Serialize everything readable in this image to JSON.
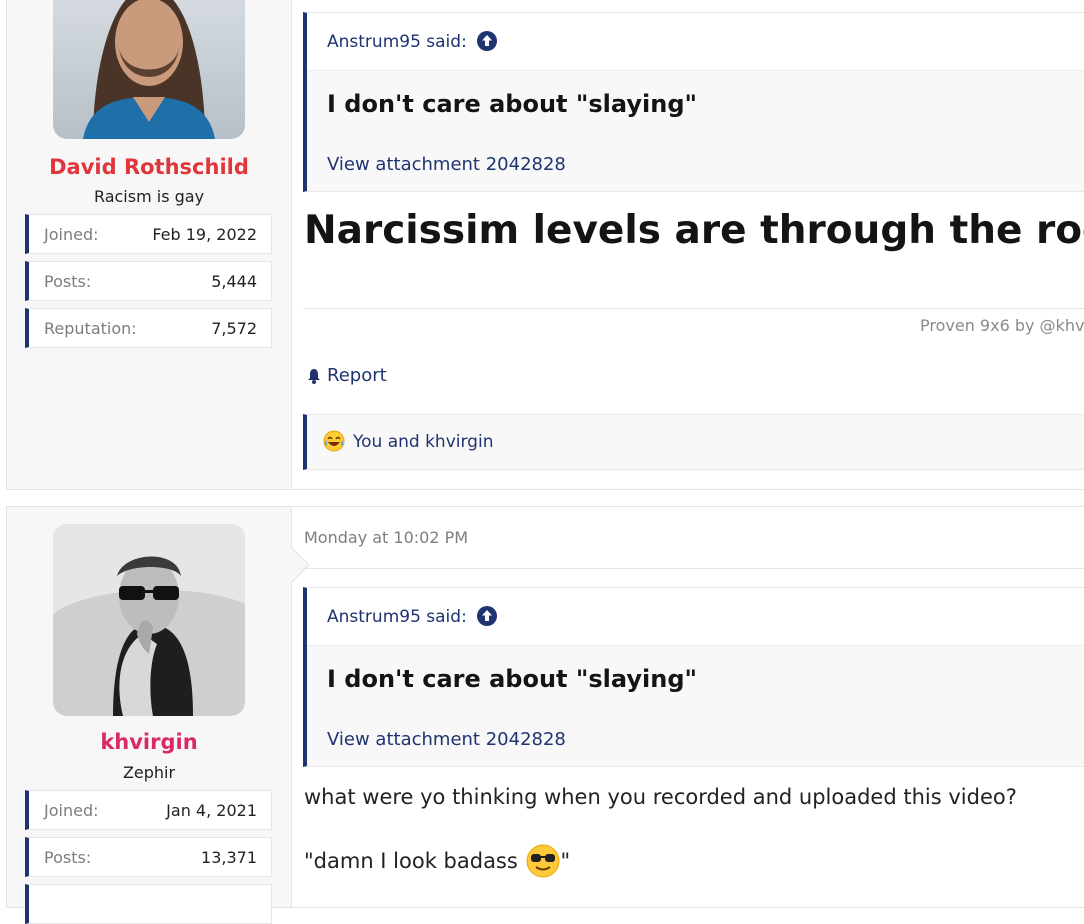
{
  "post1": {
    "user": {
      "name": "David Rothschild",
      "name_color": "#e0353b",
      "title": "Racism is gay",
      "stats": [
        {
          "label": "Joined:",
          "value": "Feb 19, 2022"
        },
        {
          "label": "Posts:",
          "value": "5,444"
        },
        {
          "label": "Reputation:",
          "value": "7,572"
        }
      ]
    },
    "quote": {
      "author": "Anstrum95 said:",
      "title": "I don't care about \"slaying\"",
      "attachment": "View attachment 2042828"
    },
    "body": "Narcissim levels are through the roof",
    "signature": "Proven 9x6 by @khv",
    "report_label": "Report",
    "reactions_text": "You and khvirgin"
  },
  "post2": {
    "user": {
      "name": "khvirgin",
      "name_color": "#d92a63",
      "title": "Zephir",
      "stats": [
        {
          "label": "Joined:",
          "value": "Jan 4, 2021"
        },
        {
          "label": "Posts:",
          "value": "13,371"
        }
      ]
    },
    "date": "Monday at 10:02 PM",
    "quote": {
      "author": "Anstrum95 said:",
      "title": "I don't care about \"slaying\"",
      "attachment": "View attachment 2042828"
    },
    "body_line1": "what were yo thinking when you recorded and uploaded this video?",
    "body_line2_prefix": "\"damn I look badass",
    "body_line2_suffix": "\""
  },
  "icons": {
    "quote_jump": "arrow-up-circle-icon",
    "report": "bell-icon",
    "reaction": "laughing-tears-icon",
    "emoji": "sunglasses-smiley-icon"
  },
  "colors": {
    "accent": "#1f3370",
    "username_post1": "#e0353b",
    "username_post2": "#d92a63"
  }
}
